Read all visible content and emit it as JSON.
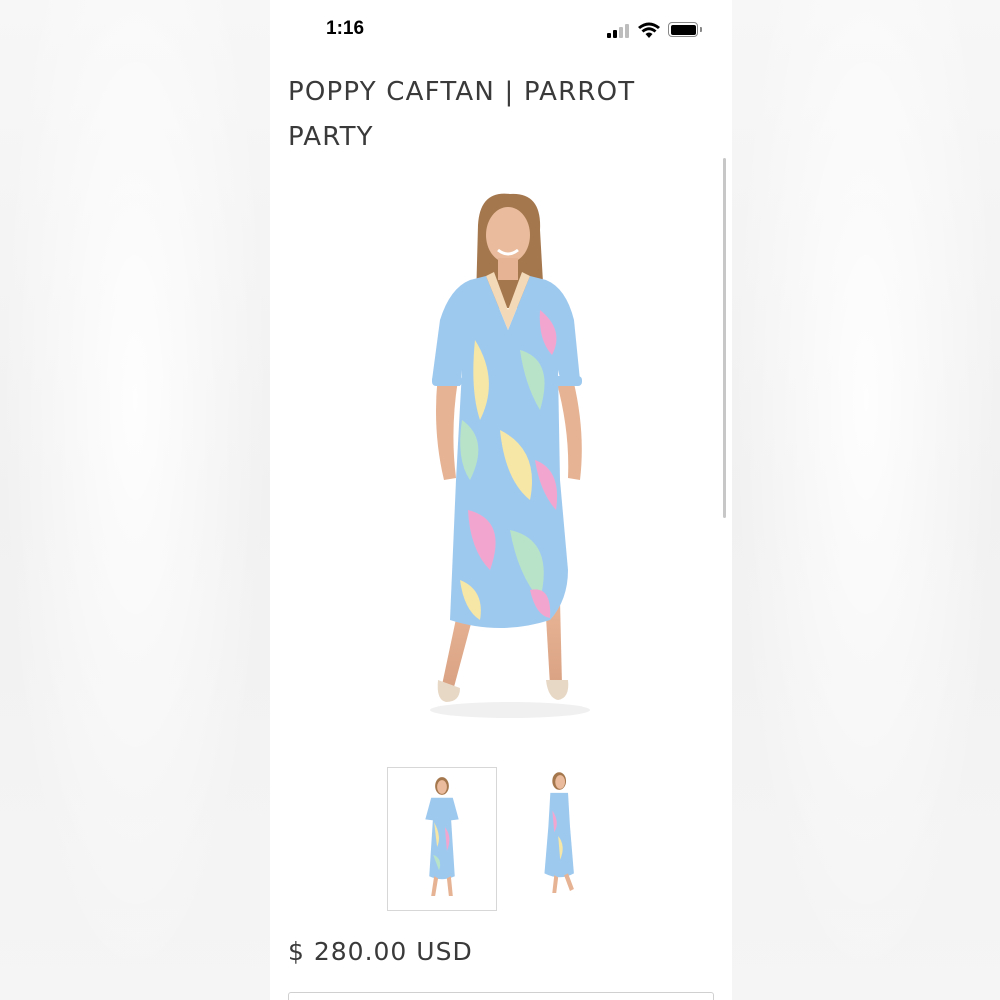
{
  "status_bar": {
    "time": "1:16",
    "signal_icon": "cellular-signal-icon",
    "wifi_icon": "wifi-icon",
    "battery_icon": "battery-icon"
  },
  "product": {
    "title": "POPPY CAFTAN | PARROT PARTY",
    "price": "$ 280.00 USD",
    "main_image_icon": "model-wearing-caftan-front-image",
    "thumbnails": [
      {
        "icon": "model-front-view-thumbnail",
        "selected": true
      },
      {
        "icon": "model-side-view-thumbnail",
        "selected": false
      }
    ]
  },
  "colors": {
    "text": "#3a3a3a",
    "dress_blue": "#9ec9ef",
    "dress_pink": "#f2a6cf",
    "dress_yellow": "#f6e7a6",
    "dress_green": "#b8e3c9"
  }
}
